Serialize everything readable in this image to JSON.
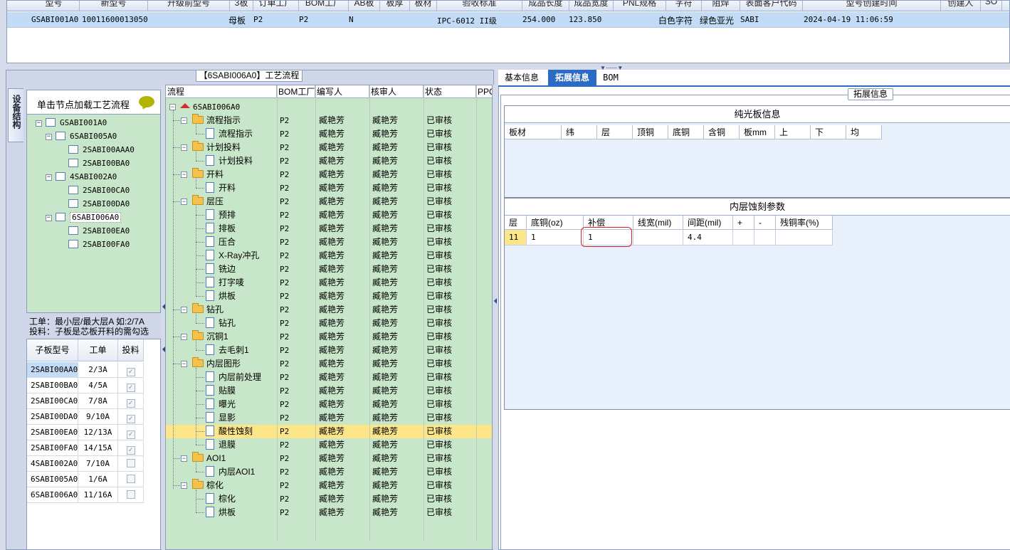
{
  "top_grid": {
    "columns": [
      "型号",
      "新型号",
      "升级前型号",
      "3板",
      "订单工厂",
      "BOM工厂",
      "AB板",
      "板厚",
      "板材",
      "验收标准",
      "成品长度",
      "成品宽度",
      "PNL规格",
      "字符",
      "阻焊",
      "表面客户代码",
      "型号创建时间",
      "创建人",
      "SO"
    ],
    "row": {
      "model": "GSABI001A0",
      "new_model": "10011600013050",
      "board_type": "母板",
      "order_factory": "P2",
      "bom_factory": "P2",
      "ab_board": "N",
      "acceptance": "IPC-6012 II级",
      "length": "254.000",
      "width": "123.850",
      "character": "白色字符",
      "solder_mask": "绿色亚光",
      "customer_code": "SABI",
      "created_time": "2024-04-19 11:06:59"
    }
  },
  "left": {
    "panel_title": "【6SABI006A0】工艺流程",
    "vertical_tab": "设备结构",
    "hint": "单击节点加载工艺流程",
    "project_tree": [
      {
        "label": "GSABI001A0",
        "level": 0
      },
      {
        "label": "6SABI005A0",
        "level": 1
      },
      {
        "label": "2SABI00AAA0",
        "level": 2
      },
      {
        "label": "2SABI00BA0",
        "level": 2
      },
      {
        "label": "4SABI002A0",
        "level": 1
      },
      {
        "label": "2SABI00CA0",
        "level": 2
      },
      {
        "label": "2SABI00DA0",
        "level": 2
      },
      {
        "label": "6SABI006A0",
        "level": 1
      },
      {
        "label": "2SABI00EA0",
        "level": 2
      },
      {
        "label": "2SABI00FA0",
        "level": 2
      }
    ],
    "notes": [
      "工单：最小层/最大层A 如:2/7A",
      "投料：子板是芯板开料的需勾选"
    ],
    "sub_table": {
      "headers": [
        "子板型号",
        "工单",
        "投料"
      ],
      "rows": [
        {
          "model": "2SABI00AA0",
          "order": "2/3A",
          "feed": true
        },
        {
          "model": "2SABI00BA0",
          "order": "4/5A",
          "feed": true
        },
        {
          "model": "2SABI00CA0",
          "order": "7/8A",
          "feed": true
        },
        {
          "model": "2SABI00DA0",
          "order": "9/10A",
          "feed": true
        },
        {
          "model": "2SABI00EA0",
          "order": "12/13A",
          "feed": true
        },
        {
          "model": "2SABI00FA0",
          "order": "14/15A",
          "feed": true
        },
        {
          "model": "4SABI002A0",
          "order": "7/10A",
          "feed": false
        },
        {
          "model": "6SABI005A0",
          "order": "1/6A",
          "feed": false
        },
        {
          "model": "6SABI006A0",
          "order": "11/16A",
          "feed": false
        }
      ]
    }
  },
  "flow": {
    "headers": [
      "流程",
      "BOM工厂",
      "编写人",
      "核审人",
      "状态",
      "PPC"
    ],
    "root": "6SABI006A0",
    "default_factory": "P2",
    "default_author": "臧艳芳",
    "default_reviewer": "臧艳芳",
    "default_status": "已审核",
    "rows": [
      {
        "name": "流程指示",
        "type": "folder"
      },
      {
        "name": "流程指示",
        "type": "doc"
      },
      {
        "name": "计划投料",
        "type": "folder"
      },
      {
        "name": "计划投料",
        "type": "doc"
      },
      {
        "name": "开料",
        "type": "folder"
      },
      {
        "name": "开料",
        "type": "doc"
      },
      {
        "name": "层压",
        "type": "folder"
      },
      {
        "name": "预排",
        "type": "doc"
      },
      {
        "name": "排板",
        "type": "doc"
      },
      {
        "name": "压合",
        "type": "doc"
      },
      {
        "name": "X-Ray冲孔",
        "type": "doc"
      },
      {
        "name": "铣边",
        "type": "doc"
      },
      {
        "name": "打字唛",
        "type": "doc"
      },
      {
        "name": "烘板",
        "type": "doc"
      },
      {
        "name": "钻孔",
        "type": "folder"
      },
      {
        "name": "钻孔",
        "type": "doc"
      },
      {
        "name": "沉铜1",
        "type": "folder"
      },
      {
        "name": "去毛刺1",
        "type": "doc"
      },
      {
        "name": "内层图形",
        "type": "folder"
      },
      {
        "name": "内层前处理",
        "type": "doc"
      },
      {
        "name": "贴膜",
        "type": "doc"
      },
      {
        "name": "曝光",
        "type": "doc"
      },
      {
        "name": "显影",
        "type": "doc"
      },
      {
        "name": "酸性蚀刻",
        "type": "doc",
        "selected": true
      },
      {
        "name": "退膜",
        "type": "doc"
      },
      {
        "name": "AOI1",
        "type": "folder"
      },
      {
        "name": "内层AOI1",
        "type": "doc"
      },
      {
        "name": "棕化",
        "type": "folder"
      },
      {
        "name": "棕化",
        "type": "doc"
      },
      {
        "name": "烘板",
        "type": "doc"
      }
    ]
  },
  "right": {
    "tabs": [
      "基本信息",
      "拓展信息",
      "BOM"
    ],
    "active_tab": "拓展信息",
    "ext_label": "拓展信息",
    "sec1": {
      "title": "纯光板信息",
      "headers": [
        "板材",
        "纬",
        "层",
        "顶铜",
        "底铜",
        "含铜",
        "板mm",
        "上",
        "下",
        "均"
      ]
    },
    "sec2": {
      "title": "内层蚀刻参数",
      "headers": [
        "层",
        "底铜(oz)",
        "补偿",
        "线宽(mil)",
        "间距(mil)",
        "+",
        "-",
        "残铜率(%)"
      ],
      "row": {
        "layer": "11",
        "base_copper": "1",
        "compensation": "1",
        "line_width": "",
        "spacing": "4.4",
        "plus": "",
        "minus": "",
        "residual": ""
      }
    }
  },
  "colors": {
    "accent": "#2c6bc4",
    "tree_bg": "#c8e6c9",
    "selected_row": "#fde68a",
    "highlight": "#dd2222"
  }
}
